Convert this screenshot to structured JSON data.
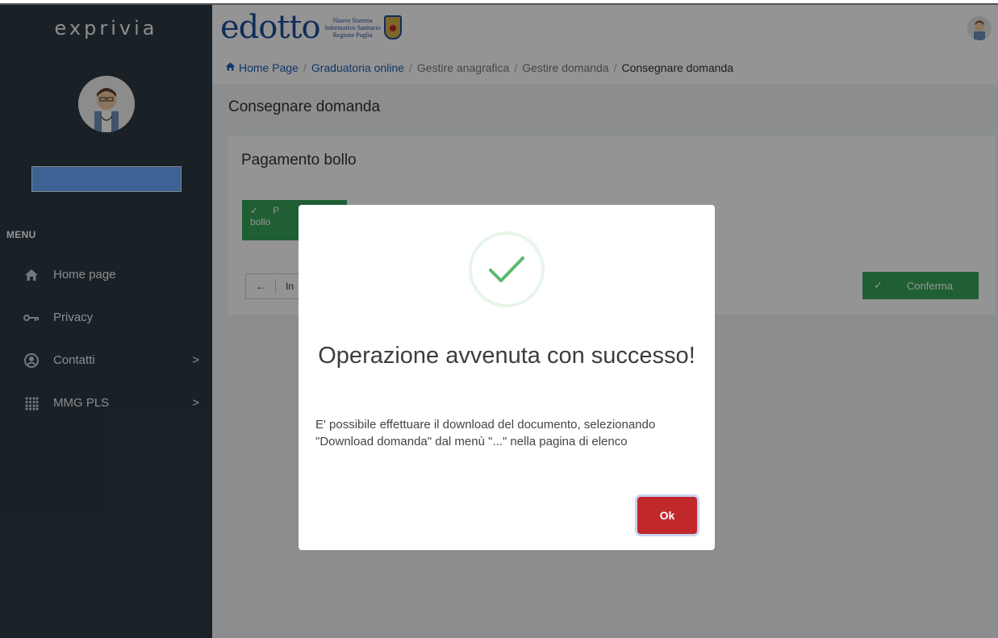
{
  "sidebar": {
    "brand": "exprivia",
    "username": "",
    "menu_label": "MENU",
    "items": [
      {
        "label": "Home page",
        "icon": "home-icon",
        "has_submenu": false
      },
      {
        "label": "Privacy",
        "icon": "key-icon",
        "has_submenu": false
      },
      {
        "label": "Contatti",
        "icon": "user-circle-icon",
        "has_submenu": true
      },
      {
        "label": "MMG PLS",
        "icon": "grid-icon",
        "has_submenu": true
      }
    ],
    "chevron": ">"
  },
  "header": {
    "logo_word": "edotto",
    "logo_sub_1": "Nuovo Sistema",
    "logo_sub_2": "Informativo Sanitario",
    "logo_sub_3": "Regione Puglia"
  },
  "breadcrumb": {
    "items": [
      "Home Page",
      "Graduatoria online",
      "Gestire anagrafica",
      "Gestire domanda",
      "Consegnare domanda"
    ],
    "separator": "/"
  },
  "page": {
    "title": "Consegnare domanda",
    "card_title": "Pagamento bollo",
    "paga_label_1": "P",
    "paga_label_2": "bollo",
    "back_label": "In",
    "confirm_label": "Conferma"
  },
  "modal": {
    "title": "Operazione avvenuta con successo!",
    "text": "E' possibile effettuare il download del documento, selezionando \"Download domanda\" dal menù \"...\" nella pagina di elenco",
    "ok_label": "Ok"
  },
  "colors": {
    "sidebar_bg": "#2c3a44",
    "primary_green": "#38a35a",
    "danger_red": "#c0282a",
    "link_blue": "#1b5fb4"
  }
}
